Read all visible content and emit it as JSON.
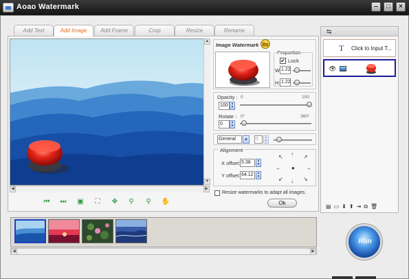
{
  "window": {
    "title": "Aoao Watermark"
  },
  "tabs": [
    {
      "label": "Add Text"
    },
    {
      "label": "Add Image"
    },
    {
      "label": "Add Frame"
    },
    {
      "label": "Crop"
    },
    {
      "label": "Resize"
    },
    {
      "label": "Rename"
    }
  ],
  "image_watermark": {
    "title": "Image Watermark",
    "proportion_label": "Proportion",
    "lock_label": "Lock",
    "lock_checked": true,
    "w_label": "W:",
    "w_value": "1.22",
    "h_label": "H:",
    "h_value": "1.22"
  },
  "opacity": {
    "label": "Opacity :",
    "min": "0",
    "max": "100",
    "value": "100"
  },
  "rotate": {
    "label": "Rotate :",
    "min": "0",
    "max": "360",
    "deg": "°",
    "value": "0"
  },
  "blend": {
    "mode": "General",
    "value": "0"
  },
  "alignment": {
    "title": "Alignment",
    "x_label": "X offset:",
    "x_value": "5.38",
    "y_label": "Y offset:",
    "y_value": "64.12"
  },
  "resize_option": {
    "label": "Resize watermarks to adapt all images.",
    "checked": false
  },
  "ok_label": "Ok",
  "layers": {
    "text_layer_label": "Click to Input T...",
    "text_layer_icon": "T"
  },
  "run_label": "Run",
  "colors": {
    "accent_tab": "#e46a1a",
    "selection": "#1c1c9c",
    "player_controls": "#2a9a3a"
  }
}
